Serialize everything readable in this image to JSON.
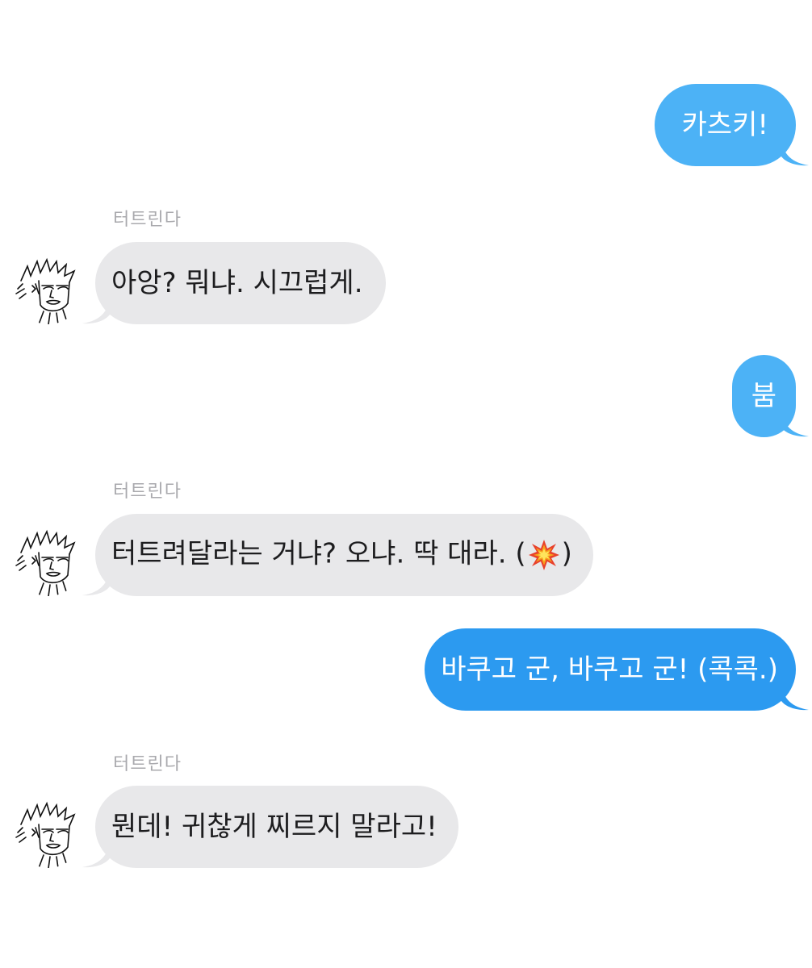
{
  "theme": {
    "bubble_out_color": "#2c9af0",
    "bubble_out_light": "#4cb2f6",
    "bubble_in_color": "#e8e8ea"
  },
  "contact": {
    "name": "터트린다",
    "avatar_icon": "spiky-hair-character-avatar-icon"
  },
  "messages": [
    {
      "direction": "outgoing",
      "text": "카츠키!"
    },
    {
      "direction": "incoming",
      "sender": "터트린다",
      "text": "아앙? 뭐냐. 시끄럽게."
    },
    {
      "direction": "outgoing",
      "text": "붐"
    },
    {
      "direction": "incoming",
      "sender": "터트린다",
      "text_before": "터트려달라는 거냐? 오냐. 딱 대라. (",
      "emoji": "collision-emoji",
      "text_after": ")"
    },
    {
      "direction": "outgoing",
      "text": "바쿠고 군, 바쿠고 군! (콕콕.)"
    },
    {
      "direction": "incoming",
      "sender": "터트린다",
      "text": "뭔데! 귀찮게 찌르지 말라고!"
    }
  ]
}
